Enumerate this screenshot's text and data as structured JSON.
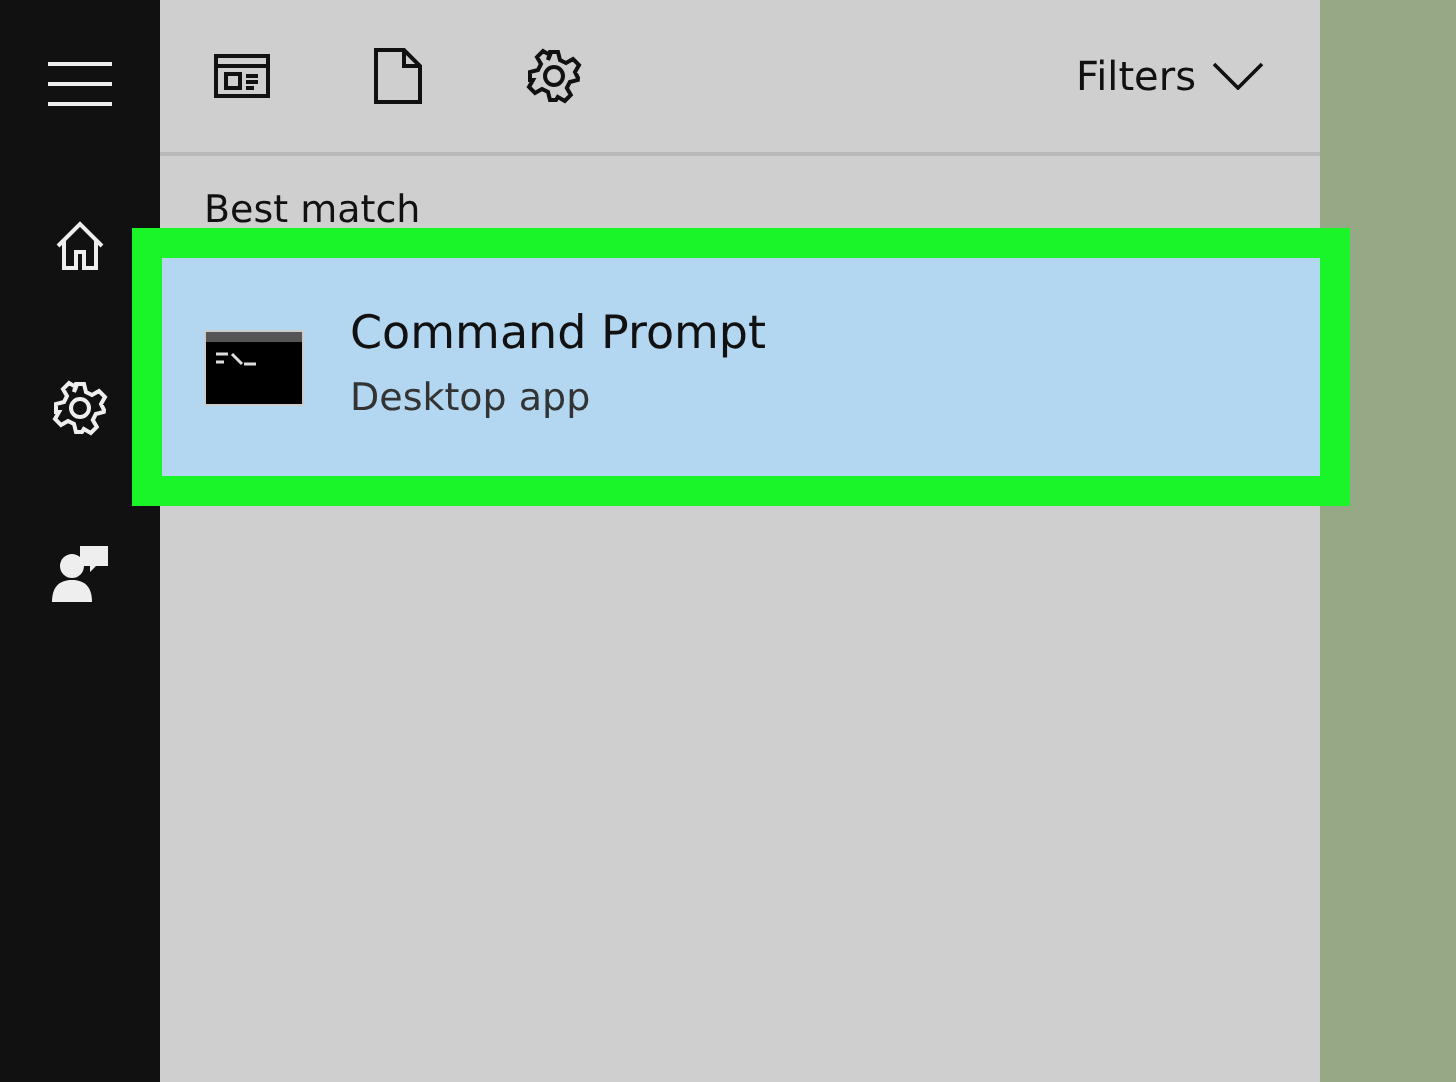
{
  "toolbar": {
    "filters": "Filters"
  },
  "section": "Best match",
  "results": [
    {
      "title": "Command Prompt",
      "subtitle": "Desktop app",
      "selected": true,
      "highlighted": true
    }
  ]
}
